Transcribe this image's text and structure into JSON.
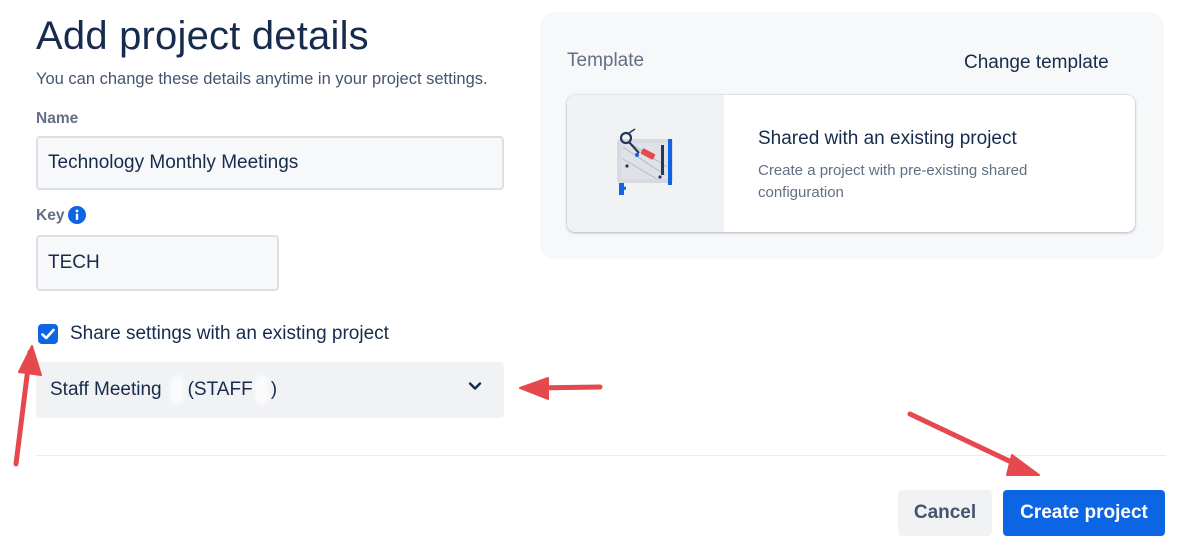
{
  "header": {
    "title": "Add project details",
    "subtitle": "You can change these details anytime in your project settings."
  },
  "form": {
    "name_label": "Name",
    "name_value": "Technology Monthly Meetings",
    "key_label": "Key",
    "key_value": "TECH",
    "share_label": "Share settings with an existing project",
    "share_checked": true,
    "project_select": {
      "name": "Staff Meeting",
      "key": "(STAFF",
      "key_close": ")"
    }
  },
  "template_panel": {
    "label": "Template",
    "change_link": "Change template",
    "card_title": "Shared with an existing project",
    "card_description": "Create a project with pre-existing shared configuration"
  },
  "footer": {
    "cancel_label": "Cancel",
    "create_label": "Create project"
  },
  "colors": {
    "primary": "#0c66e4",
    "annotation_arrow": "#e5484d",
    "text": "#172b4d",
    "subtle_text": "#626f86"
  }
}
